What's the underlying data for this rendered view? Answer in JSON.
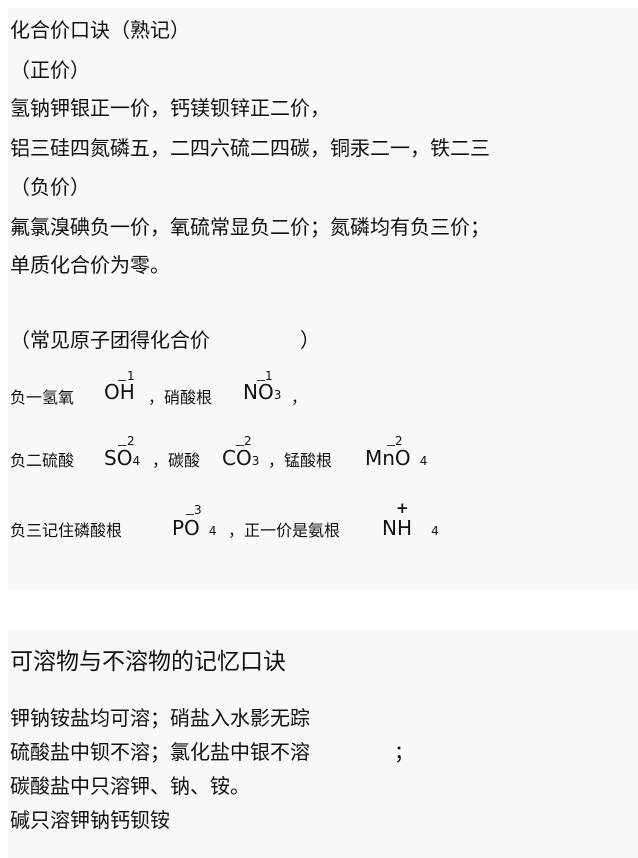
{
  "section1": {
    "title": "化合价口诀（熟记）",
    "positive_heading": "（正价）",
    "positive_line1": "氢钠钾银正一价，钙镁钡锌正二价，",
    "positive_line2": "铝三硅四氮磷五，二四六硫二四碳，铜汞二一，铁二三",
    "negative_heading": "（负价）",
    "negative_line1": "氟氯溴碘负一价，氧硫常显负二价；氮磷均有负三价；",
    "element_zero": "单质化合价为零。",
    "group_heading": "（常见原子团得化合价",
    "group_heading_close": "）"
  },
  "radicals": {
    "row1_label": "负一氢氧",
    "oh": {
      "main": "OH",
      "charge": "1"
    },
    "row1_mid": "，硝酸根",
    "no3": {
      "main": "NO",
      "sub": "3",
      "charge": "1"
    },
    "row1_end": "，",
    "row2_label": "负二硫酸",
    "so4": {
      "main": "SO",
      "sub": "4",
      "charge": "2"
    },
    "row2_mid": "，碳酸",
    "co3": {
      "main": "CO",
      "sub": "3",
      "charge": "2"
    },
    "row2_mid2": "，锰酸根",
    "mno4": {
      "main": "MnO",
      "sub": "4",
      "charge": "2"
    },
    "row3_label": "负三记住磷酸根",
    "po4": {
      "main": "PO",
      "sub": "4",
      "charge": "3"
    },
    "row3_mid": "，正一价是氨根",
    "nh4": {
      "main": "NH",
      "sub": "4",
      "charge": "+"
    }
  },
  "section2": {
    "title": "可溶物与不溶物的记忆口诀",
    "line1": "钾钠铵盐均可溶；硝盐入水影无踪",
    "line2": "硫酸盐中钡不溶；氯化盐中银不溶",
    "line2_end": "；",
    "line3": "碳酸盐中只溶钾、钠、铵。",
    "line4": "碱只溶钾钠钙钡铵"
  }
}
